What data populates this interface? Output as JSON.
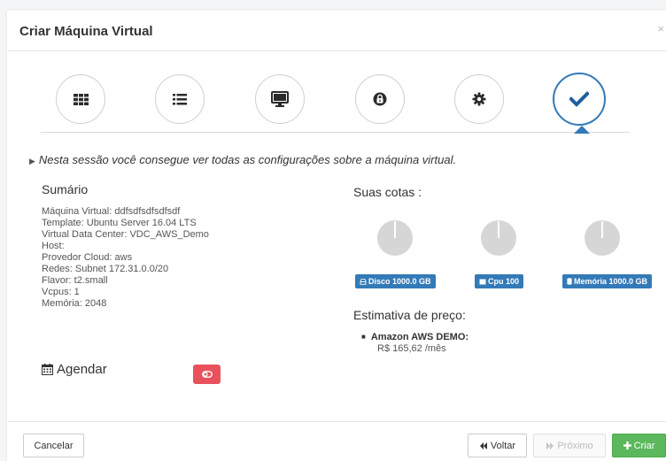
{
  "modal": {
    "title": "Criar Máquina Virtual",
    "close_label": "×"
  },
  "wizard": {
    "steps": [
      {
        "icon": "grid-icon"
      },
      {
        "icon": "list-icon"
      },
      {
        "icon": "monitor-icon"
      },
      {
        "icon": "lock-icon"
      },
      {
        "icon": "gear-icon"
      },
      {
        "icon": "check-icon",
        "active": true
      }
    ],
    "accent_color": "#337ab7"
  },
  "intro": "Nesta sessão você consegue ver todas as configurações sobre a máquina virtual.",
  "summary": {
    "title": "Sumário",
    "lines": [
      "Máquina Virtual: ddfsdfsdfsdfsdf",
      "Template: Ubuntu Server 16.04 LTS",
      "Virtual Data Center: VDC_AWS_Demo",
      "Host:",
      "Provedor Cloud: aws",
      "Redes: Subnet 172.31.0.0/20",
      "Flavor: t2.small",
      "Vcpus: 1",
      "Memória: 2048"
    ]
  },
  "schedule": {
    "label": "Agendar"
  },
  "quotas": {
    "title": "Suas cotas :",
    "items": [
      {
        "label": "Disco 1000.0 GB",
        "icon": "disk-icon"
      },
      {
        "label": "Cpu 100",
        "icon": "cpu-icon"
      },
      {
        "label": "Memória 1000.0 GB",
        "icon": "memory-icon"
      }
    ]
  },
  "pricing": {
    "title": "Estimativa de preço:",
    "provider": "Amazon AWS DEMO:",
    "value": "R$ 165,62 /mês"
  },
  "footer": {
    "cancel": "Cancelar",
    "back": "Voltar",
    "next": "Próximo",
    "create": "Criar"
  }
}
